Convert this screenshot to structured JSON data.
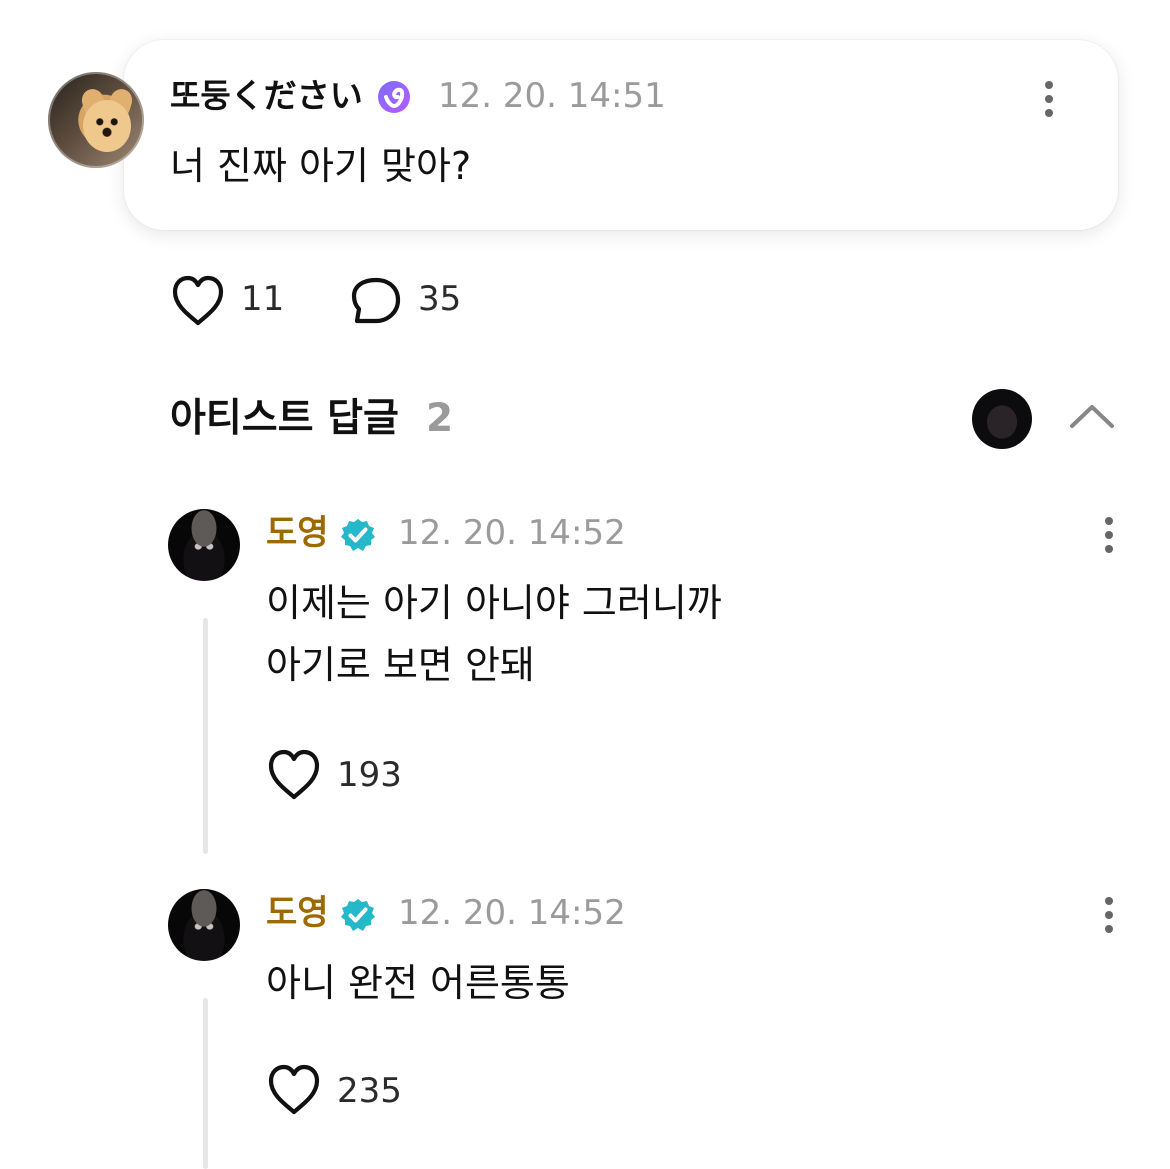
{
  "post": {
    "username": "또둥ください",
    "timestamp": "12. 20. 14:51",
    "text": "너 진짜 아기 맞아?",
    "likes": "11",
    "comments": "35",
    "icons": {
      "avatar": "avatar-dog-icon",
      "verified": "verified-badge-icon",
      "menu": "more-vertical-icon",
      "like": "heart-icon",
      "comment": "comment-bubble-icon"
    }
  },
  "artist_replies": {
    "title": "아티스트 답글",
    "count": "2",
    "icons": {
      "avatar": "artist-avatar-icon",
      "collapse": "chevron-up-icon"
    }
  },
  "replies": [
    {
      "author": "도영",
      "timestamp": "12. 20. 14:52",
      "text": "이제는 아기 아니야 그러니까\n아기로 보면 안돼",
      "likes": "193"
    },
    {
      "author": "도영",
      "timestamp": "12. 20. 14:52",
      "text": "아니 완전 어른통통",
      "likes": "235"
    }
  ],
  "colors": {
    "background": "#ffffff",
    "artist_name": "#9c6a00",
    "verified_purple": "#8a4dff",
    "verified_teal": "#25b8c8",
    "timestamp": "#9b9b9b",
    "thread_line": "#e6e6e6"
  }
}
